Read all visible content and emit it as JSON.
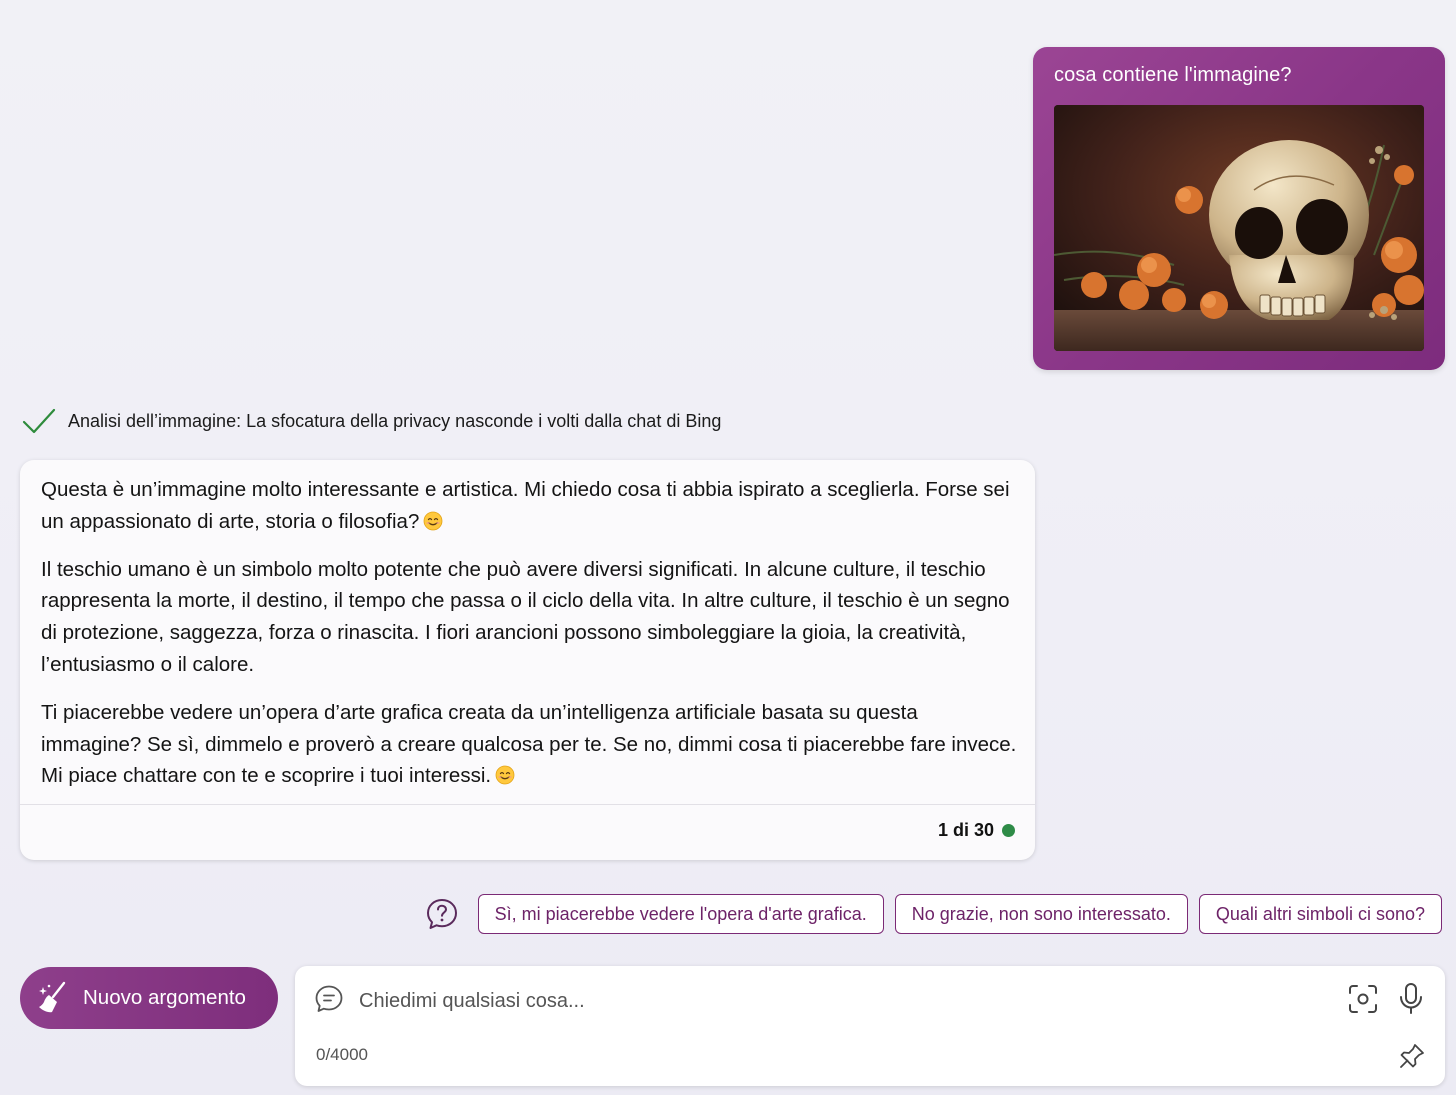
{
  "user_message": {
    "text": "cosa contiene l'immagine?"
  },
  "analysis": {
    "text": "Analisi dell’immagine: La sfocatura della privacy nasconde i volti dalla chat di Bing"
  },
  "bot_response": {
    "paragraph_1": "Questa è un’immagine molto interessante e artistica. Mi chiedo cosa ti abbia ispirato a sceglierla. Forse sei un appassionato di arte, storia o filosofia?",
    "paragraph_2": "Il teschio umano è un simbolo molto potente che può avere diversi significati. In alcune culture, il teschio rappresenta la morte, il destino, il tempo che passa o il ciclo della vita. In altre culture, il teschio è un segno di protezione, saggezza, forza o rinascita. I fiori arancioni possono simboleggiare la gioia, la creatività, l’entusiasmo o il calore.",
    "paragraph_3": "Ti piacerebbe vedere un’opera d’arte grafica creata da un’intelligenza artificiale basata su questa immagine? Se sì, dimmelo e proverò a creare qualcosa per te. Se no, dimmi cosa ti piacerebbe fare invece. Mi piace chattare con te e scoprire i tuoi interessi.",
    "counter": "1 di 30",
    "status_color": "#2e8b47"
  },
  "suggestions": [
    "Sì, mi piacerebbe vedere l'opera d'arte grafica.",
    "No grazie, non sono interessato.",
    "Quali altri simboli ci sono?"
  ],
  "new_topic": {
    "label": "Nuovo argomento"
  },
  "input": {
    "placeholder": "Chiedimi qualsiasi cosa...",
    "char_count": "0/4000"
  },
  "colors": {
    "accent": "#7e2e7c",
    "user_bubble": "#8a3688",
    "check": "#2e8b3c"
  },
  "icons": {
    "analysis": "check-icon",
    "emoji": "smiling-face-icon",
    "suggestions": "question-icon",
    "new_topic": "broom-icon",
    "input": "chat-bubble-icon",
    "visual_search": "visual-search-icon",
    "microphone": "microphone-icon",
    "pin": "pin-icon"
  }
}
